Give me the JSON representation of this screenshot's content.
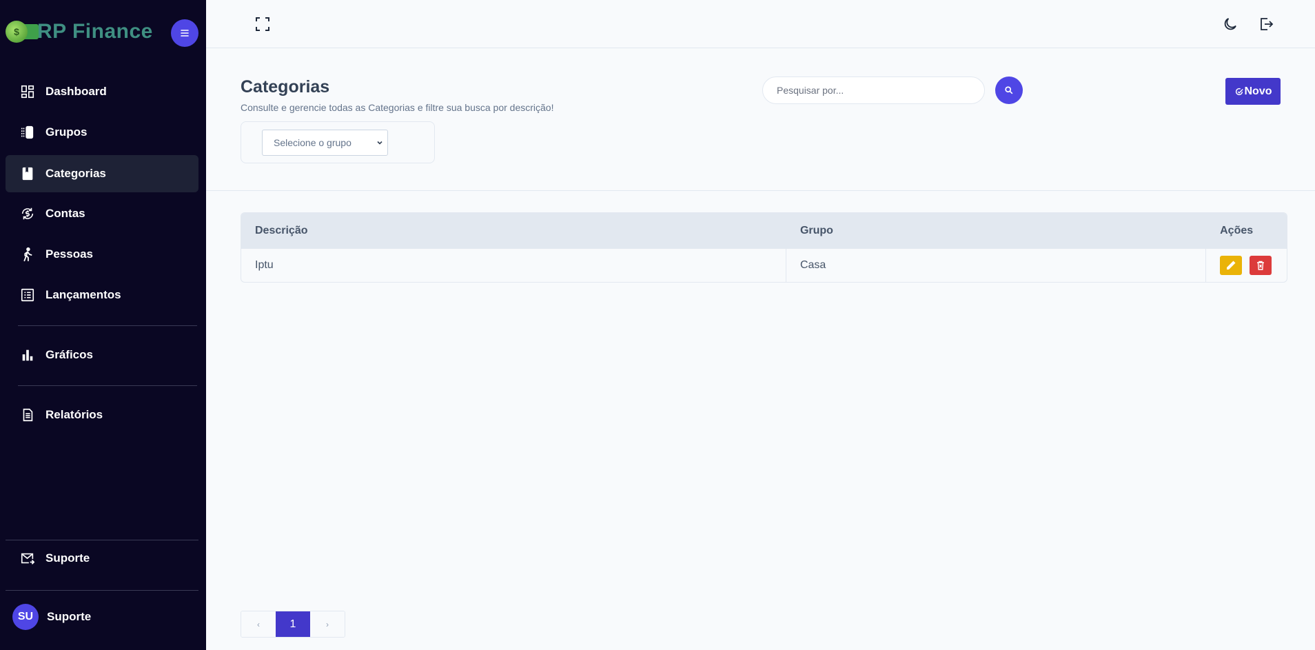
{
  "sidebar": {
    "brand": "RP Finance",
    "nav": [
      {
        "label": "Dashboard",
        "icon": "dashboard-icon"
      },
      {
        "label": "Grupos",
        "icon": "groups-icon"
      },
      {
        "label": "Categorias",
        "icon": "book-icon",
        "active": true
      },
      {
        "label": "Contas",
        "icon": "currency-exchange-icon"
      },
      {
        "label": "Pessoas",
        "icon": "person-walking-icon"
      },
      {
        "label": "Lançamentos",
        "icon": "list-icon"
      },
      {
        "label": "Gráficos",
        "icon": "bar-chart-icon"
      },
      {
        "label": "Relatórios",
        "icon": "document-icon"
      }
    ],
    "support": {
      "label": "Suporte",
      "icon": "mail-icon"
    },
    "user": {
      "initials": "SU",
      "name": "Suporte"
    }
  },
  "header": {
    "title": "Categorias",
    "subtitle": "Consulte e gerencie todas as Categorias e filtre sua busca por descrição!",
    "group_select_placeholder": "Selecione o grupo",
    "search_placeholder": "Pesquisar por...",
    "new_label": "Novo"
  },
  "table": {
    "columns": [
      "Descrição",
      "Grupo",
      "Ações"
    ],
    "rows": [
      {
        "descricao": "Iptu",
        "grupo": "Casa"
      }
    ]
  },
  "pagination": {
    "prev": "‹",
    "current": "1",
    "next": "›"
  },
  "colors": {
    "sidebar_bg": "#0a0723",
    "accent": "#4338ca",
    "edit": "#eab308",
    "delete": "#dc3b3b"
  }
}
